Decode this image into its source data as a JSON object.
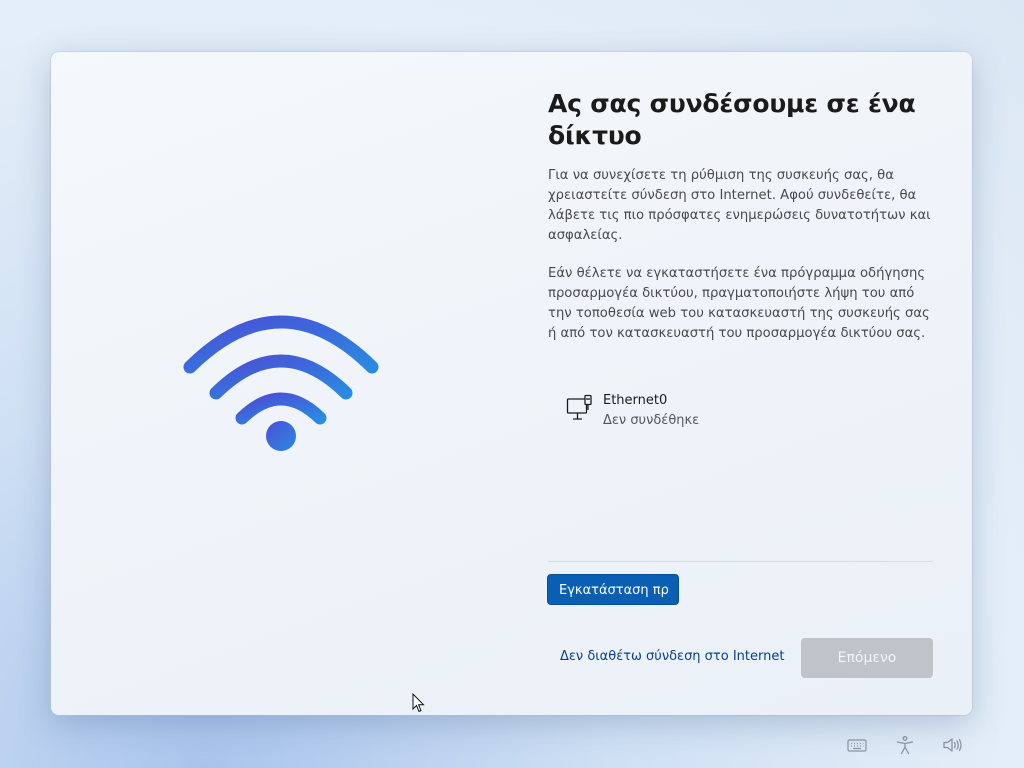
{
  "dialog": {
    "title": "Ας σας συνδέσουμε σε ένα δίκτυο",
    "paragraph1": "Για να συνεχίσετε τη ρύθμιση της συσκευής σας, θα χρειαστείτε σύνδεση στο Internet. Αφού συνδεθείτε, θα λάβετε τις πιο πρόσφατες ενημερώσεις δυνατοτήτων και ασφαλείας.",
    "paragraph2": "Εάν θέλετε να εγκαταστήσετε ένα πρόγραμμα οδήγησης προσαρμογέα δικτύου, πραγματοποιήστε λήψη του από την τοποθεσία web του κατασκευαστή της συσκευής σας ή από τον κατασκευαστή του προσαρμογέα δικτύου σας."
  },
  "network": {
    "name": "Ethernet0",
    "status": "Δεν συνδέθηκε",
    "icon": "ethernet-icon"
  },
  "buttons": {
    "install_driver": "Εγκατάσταση πρ",
    "no_internet": "Δεν διαθέτω σύνδεση στο Internet",
    "next": "Επόμενο"
  },
  "tray": {
    "icons": [
      "keyboard-icon",
      "accessibility-icon",
      "volume-icon"
    ]
  },
  "colors": {
    "accent": "#0a5fb5",
    "link": "#0c3f8a",
    "disabled": "#bfc4cb",
    "wifi_start": "#4a5bd8",
    "wifi_end": "#2a86e0"
  }
}
